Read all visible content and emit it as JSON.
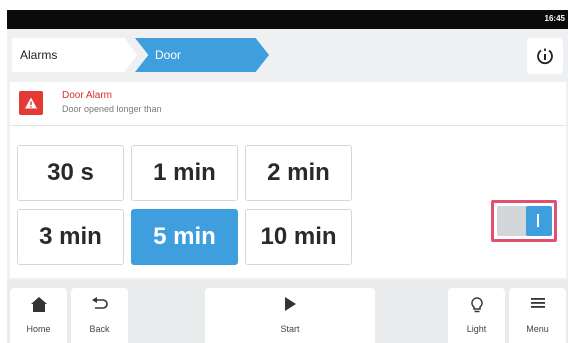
{
  "status": {
    "time": "16:45"
  },
  "breadcrumb": {
    "items": [
      {
        "label": "Alarms"
      },
      {
        "label": "Door"
      }
    ]
  },
  "alarm": {
    "title": "Door Alarm",
    "description": "Door opened longer than"
  },
  "durations": [
    {
      "label": "30 s",
      "selected": false
    },
    {
      "label": "1 min",
      "selected": false
    },
    {
      "label": "2 min",
      "selected": false
    },
    {
      "label": "3 min",
      "selected": false
    },
    {
      "label": "5 min",
      "selected": true
    },
    {
      "label": "10 min",
      "selected": false
    }
  ],
  "toggle": {
    "state": "on"
  },
  "nav": {
    "home": "Home",
    "back": "Back",
    "start": "Start",
    "light": "Light",
    "menu": "Menu"
  },
  "colors": {
    "accent": "#3f9ede",
    "alarm": "#e53935",
    "highlight": "#e05070"
  }
}
